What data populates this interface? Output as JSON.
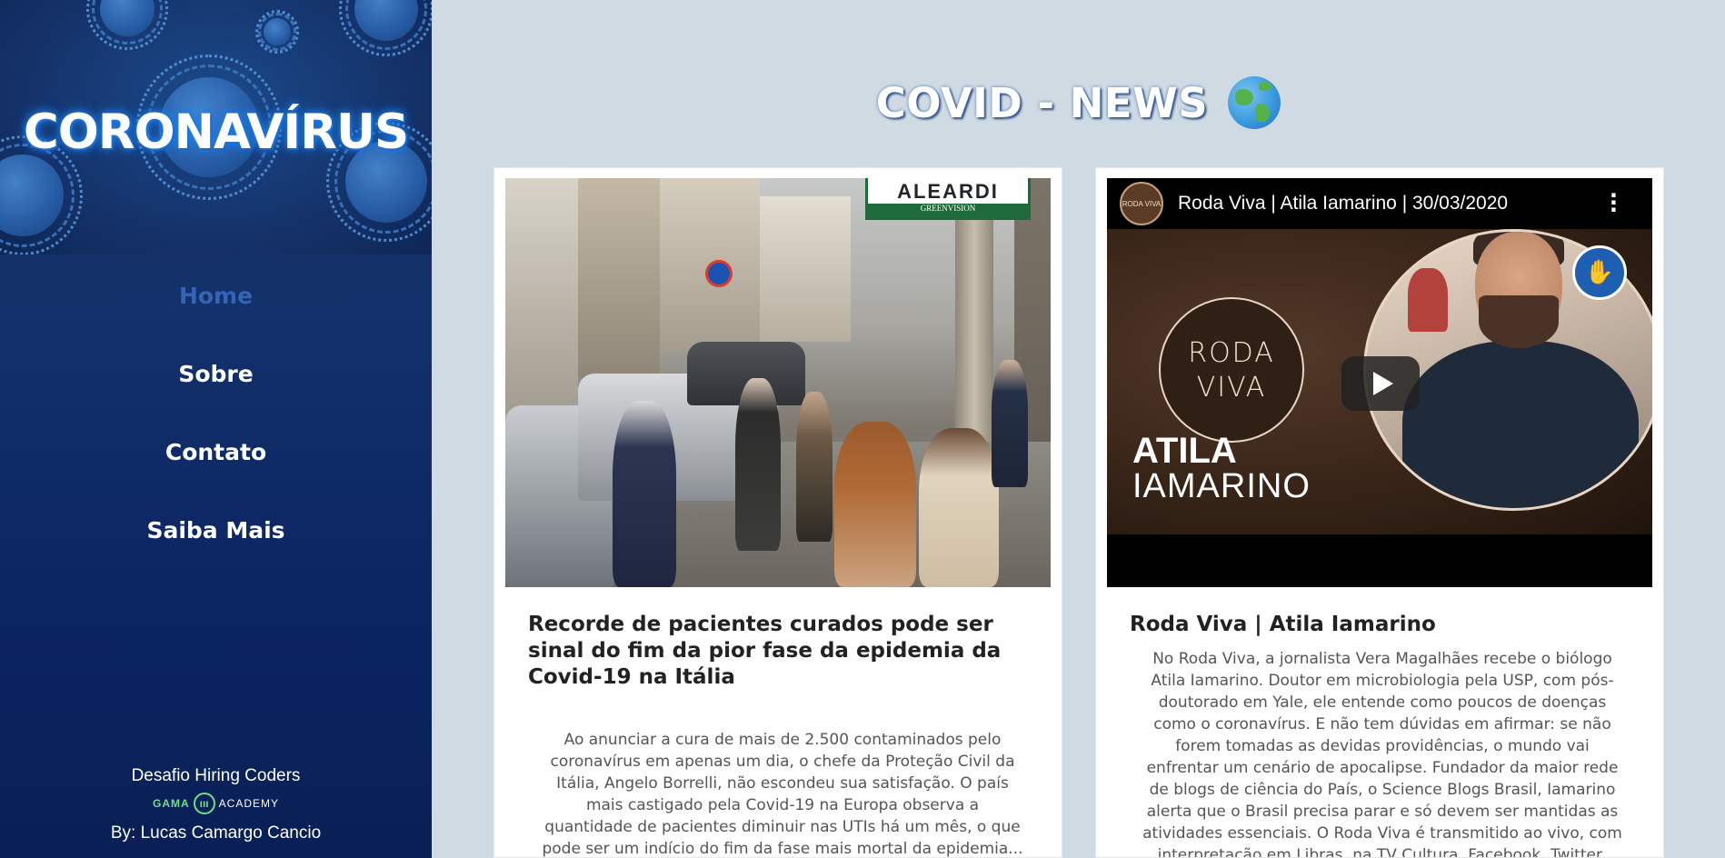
{
  "sidebar": {
    "hero_title": "CORONAVÍRUS",
    "nav": [
      {
        "label": "Home",
        "active": true
      },
      {
        "label": "Sobre",
        "active": false
      },
      {
        "label": "Contato",
        "active": false
      },
      {
        "label": "Saiba Mais",
        "active": false
      }
    ],
    "footer": {
      "challenge": "Desafio Hiring Coders",
      "gama": "GAMA",
      "academy": "ACADEMY",
      "author": "By: Lucas Camargo Cancio"
    }
  },
  "main": {
    "title": "COVID - NEWS",
    "title_icon": "globe-icon",
    "cards": [
      {
        "image_sign": "ALEARDI",
        "image_sign_sub": "GREENVISION",
        "title": "Recorde de pacientes curados pode ser sinal do fim da pior fase da epidemia da Covid-19 na Itália",
        "text": "Ao anunciar a cura de mais de 2.500 contaminados pelo coronavírus em apenas um dia, o chefe da Proteção Civil da Itália, Angelo Borrelli, não escondeu sua satisfação. O país mais castigado pela Covid-19 na Europa observa a quantidade de pacientes diminuir nas UTIs há um mês, o que pode ser um indício do fim da fase mais mortal da epidemia..."
      },
      {
        "video_title": "Roda Viva | Atila Iamarino | 30/03/2020",
        "channel": "RODA VIVA",
        "thumb_logo_1": "RODA",
        "thumb_logo_2": "VIVA",
        "thumb_name_1": "ATILA",
        "thumb_name_2": "IAMARINO",
        "title": "Roda Viva | Atila Iamarino",
        "text": "No Roda Viva, a jornalista Vera Magalhães recebe o biólogo Atila Iamarino. Doutor em microbiologia pela USP, com pós-doutorado em Yale, ele entende como poucos de doenças como o coronavírus. E não tem dúvidas em afirmar: se não forem tomadas as devidas providências, o mundo vai enfrentar um cenário de apocalipse. Fundador da maior rede de blogs de ciência do País, o Science Blogs Brasil, Iamarino alerta que o Brasil precisa parar e só devem ser mantidas as atividades essenciais. O Roda Viva é transmitido ao vivo, com interpretação em Libras, na TV Cultura, Facebook, Twitter, site..."
      }
    ]
  },
  "colors": {
    "sidebar_bg": "#12306a",
    "main_bg": "#cfdae3",
    "nav_active": "#3364b8",
    "nav_default": "#ffffff"
  }
}
